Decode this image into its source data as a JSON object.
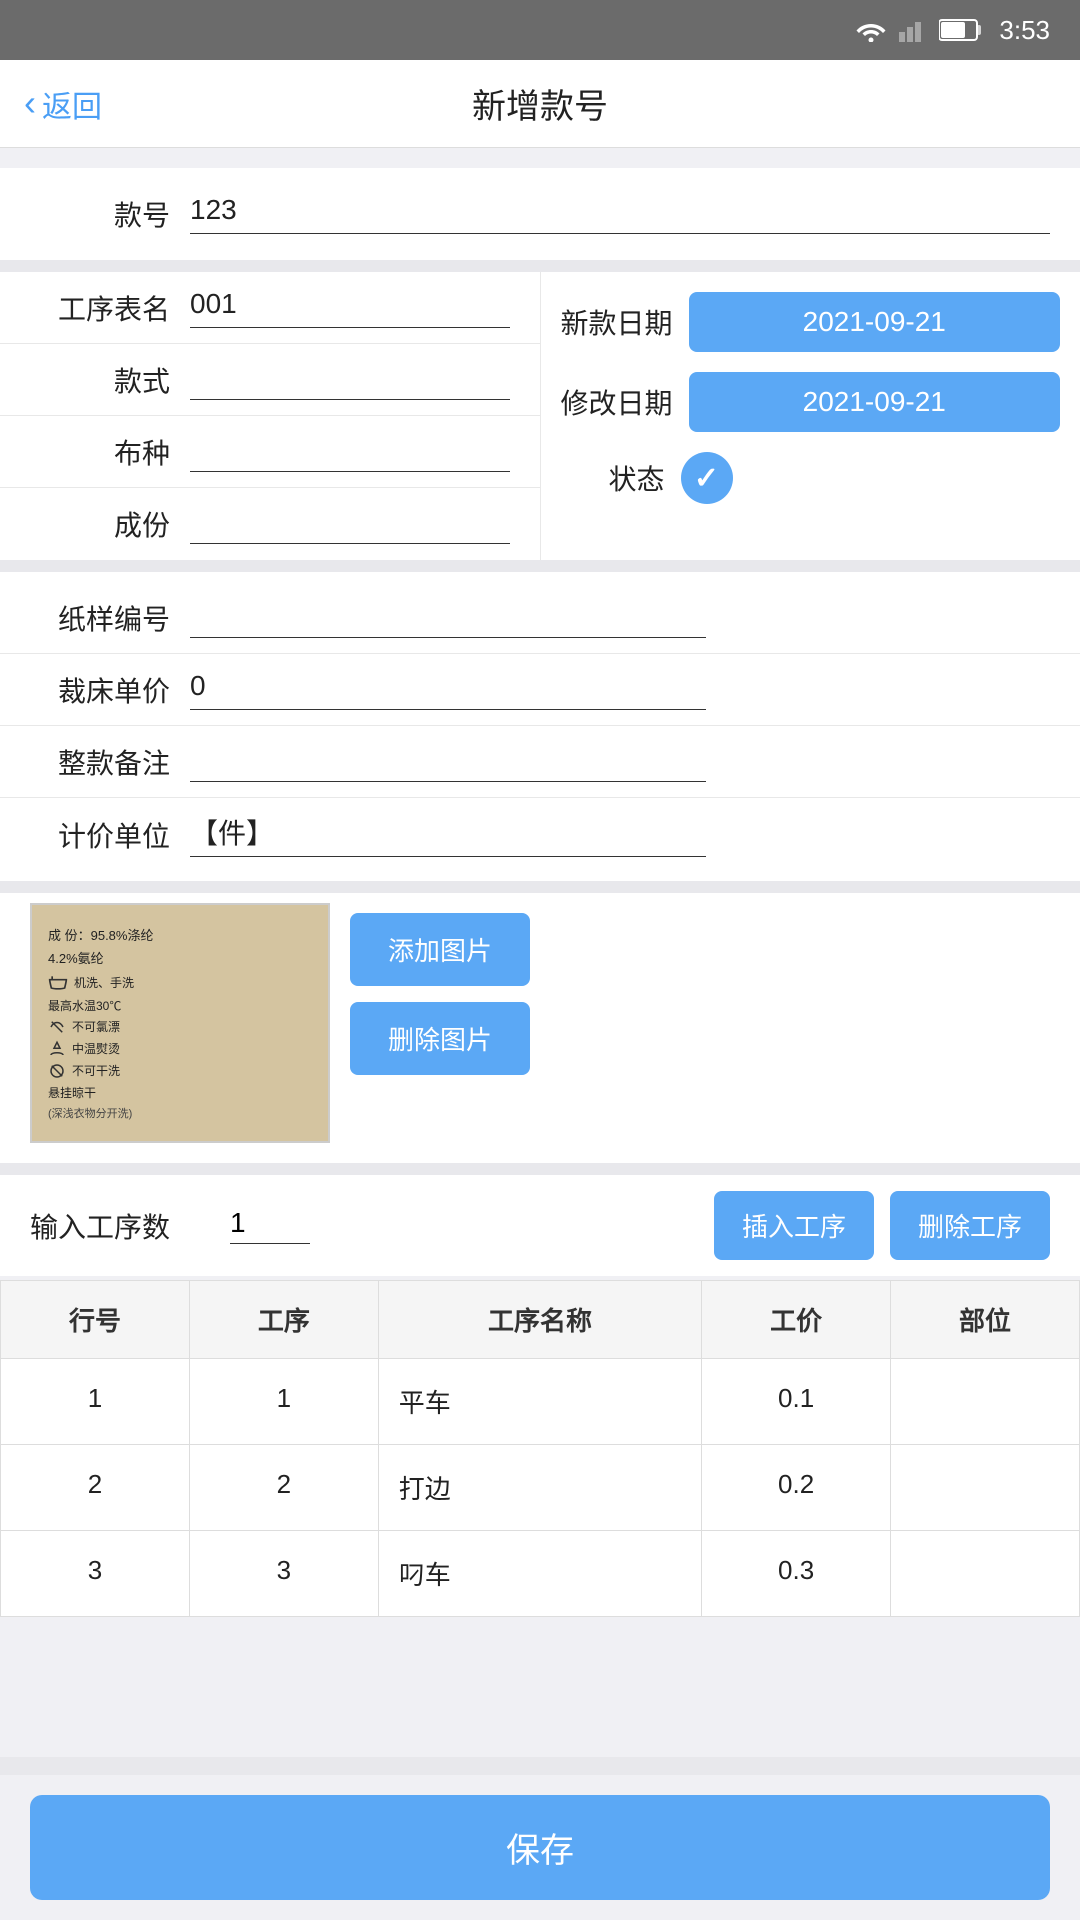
{
  "statusBar": {
    "time": "3:53"
  },
  "nav": {
    "backLabel": "返回",
    "title": "新增款号"
  },
  "form": {
    "kuanhaoLabel": "款号",
    "kuanhaoValue": "123",
    "gongxuLabel": "工序表名",
    "gongxuValue": "001",
    "kuanshiLabel": "款式",
    "kuanshiValue": "",
    "buzhongLabel": "布种",
    "buzhongValue": "",
    "chengfenLabel": "成份",
    "chengfenValue": "",
    "zhiyangLabel": "纸样编号",
    "zhiyangValue": "",
    "caichuangLabel": "裁床单价",
    "caichuangValue": "0",
    "beizhuLabel": "整款备注",
    "beizhuValue": "",
    "jiajiLabel": "计价单位",
    "jiajiValue": "【件】",
    "xinKuanLabel": "新款日期",
    "xinKuanValue": "2021-09-21",
    "xiugaiLabel": "修改日期",
    "xiugaiValue": "2021-09-21",
    "zhuangtaiLabel": "状态",
    "gongxushuLabel": "输入工序数",
    "gongxushuValue": "1"
  },
  "buttons": {
    "addImage": "添加图片",
    "deleteImage": "删除图片",
    "insertProcess": "插入工序",
    "deleteProcess": "删除工序",
    "save": "保存"
  },
  "table": {
    "headers": [
      "行号",
      "工序",
      "工序名称",
      "工价",
      "部位"
    ],
    "rows": [
      {
        "lineNo": "1",
        "process": "1",
        "name": "平车",
        "price": "0.1",
        "department": ""
      },
      {
        "lineNo": "2",
        "process": "2",
        "name": "打边",
        "price": "0.2",
        "department": ""
      },
      {
        "lineNo": "3",
        "process": "3",
        "name": "叼车",
        "price": "0.3",
        "department": ""
      }
    ]
  },
  "careLabel": {
    "line1": "成 份：95.8%涤纶",
    "line2": "4.2%氨纶",
    "line3": "机洗、手洗",
    "line4": "最高水温30℃",
    "line5": "不可氯漂",
    "line6": "中温熨烫",
    "line7": "不可干洗",
    "line8": "悬挂晾干",
    "line9": "(深浅衣物分开洗)"
  }
}
